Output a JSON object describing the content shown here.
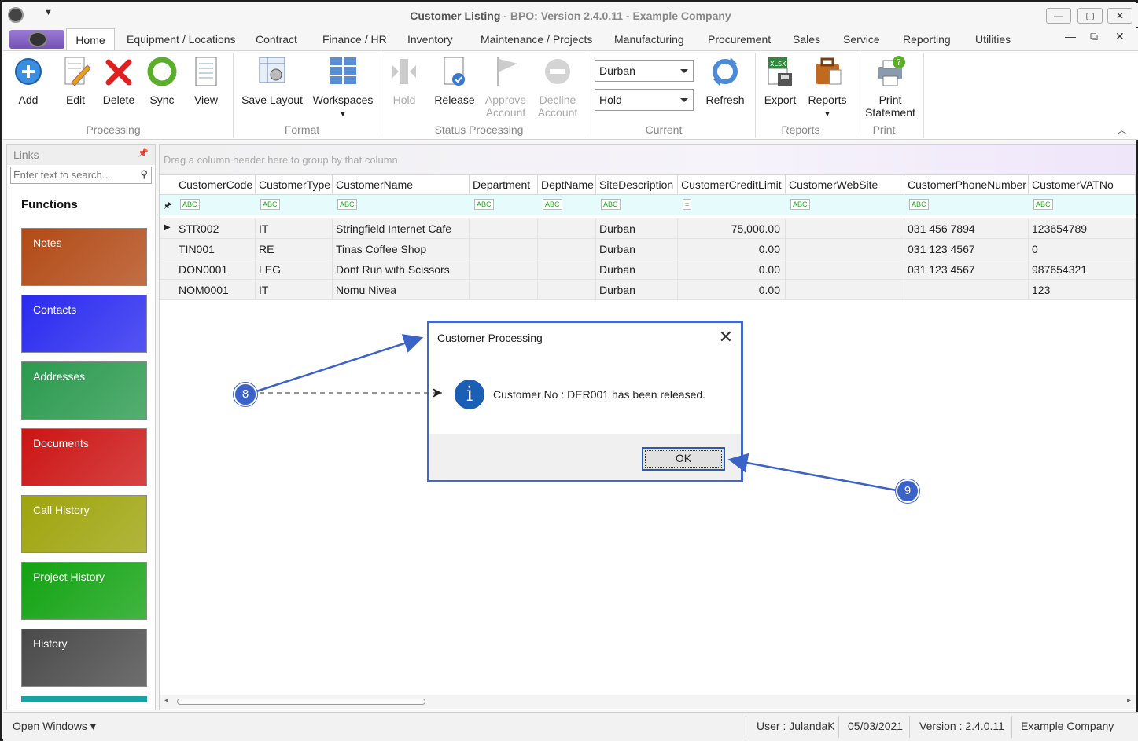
{
  "window": {
    "title_main": "Customer Listing",
    "title_rest": " - BPO: Version 2.4.0.11 - Example Company",
    "min": "—",
    "max": "▢",
    "close": "✕"
  },
  "tabs": [
    "Home",
    "Equipment / Locations",
    "Contract",
    "Finance / HR",
    "Inventory",
    "Maintenance / Projects",
    "Manufacturing",
    "Procurement",
    "Sales",
    "Service",
    "Reporting",
    "Utilities"
  ],
  "ribbon": {
    "processing": {
      "add": "Add",
      "edit": "Edit",
      "delete": "Delete",
      "sync": "Sync",
      "view": "View",
      "group": "Processing"
    },
    "format": {
      "save_layout": "Save Layout",
      "workspaces": "Workspaces",
      "group": "Format"
    },
    "status": {
      "hold": "Hold",
      "release": "Release",
      "approve1": "Approve",
      "approve2": "Account",
      "decline1": "Decline",
      "decline2": "Account",
      "group": "Status Processing"
    },
    "current": {
      "site": "Durban",
      "status": "Hold",
      "refresh": "Refresh",
      "group": "Current"
    },
    "reports": {
      "export": "Export",
      "reports": "Reports",
      "group": "Reports"
    },
    "print": {
      "print1": "Print",
      "print2": "Statement",
      "group": "Print"
    }
  },
  "left": {
    "header": "Links",
    "search_placeholder": "Enter text to search...",
    "functions": "Functions",
    "tiles": [
      {
        "label": "Notes",
        "color": "#b24a16"
      },
      {
        "label": "Contacts",
        "color": "#2a2af0"
      },
      {
        "label": "Addresses",
        "color": "#2a9a4e"
      },
      {
        "label": "Documents",
        "color": "#cc1414"
      },
      {
        "label": "Call History",
        "color": "#9ea40c"
      },
      {
        "label": "Project History",
        "color": "#12a312"
      },
      {
        "label": "History",
        "color": "#4a4a4a"
      }
    ]
  },
  "grid": {
    "group_hint": "Drag a column header here to group by that column",
    "columns": [
      "CustomerCode",
      "CustomerType",
      "CustomerName",
      "Department",
      "DeptName",
      "SiteDescription",
      "CustomerCreditLimit",
      "CustomerWebSite",
      "CustomerPhoneNumber",
      "CustomerVATNo"
    ],
    "rows": [
      [
        "STR002",
        "IT",
        "Stringfield Internet Cafe",
        "",
        "",
        "Durban",
        "75,000.00",
        "",
        "031 456 7894",
        "123654789"
      ],
      [
        "TIN001",
        "RE",
        "Tinas Coffee Shop",
        "",
        "",
        "Durban",
        "0.00",
        "",
        "031 123 4567",
        "0"
      ],
      [
        "DON0001",
        "LEG",
        "Dont Run with Scissors",
        "",
        "",
        "Durban",
        "0.00",
        "",
        "031 123 4567",
        "987654321"
      ],
      [
        "NOM0001",
        "IT",
        "Nomu Nivea",
        "",
        "",
        "Durban",
        "0.00",
        "",
        "",
        "123"
      ]
    ]
  },
  "status": {
    "open_windows": "Open Windows ▾",
    "user": "User : JulandaK",
    "date": "05/03/2021",
    "version": "Version : 2.4.0.11",
    "company": "Example Company"
  },
  "dialog": {
    "title": "Customer Processing",
    "message": "Customer No : DER001 has been released.",
    "ok": "OK",
    "info_glyph": "i",
    "close_glyph": "✕"
  },
  "annotations": {
    "step8": "8",
    "step9": "9",
    "color": "#3a62c8"
  }
}
